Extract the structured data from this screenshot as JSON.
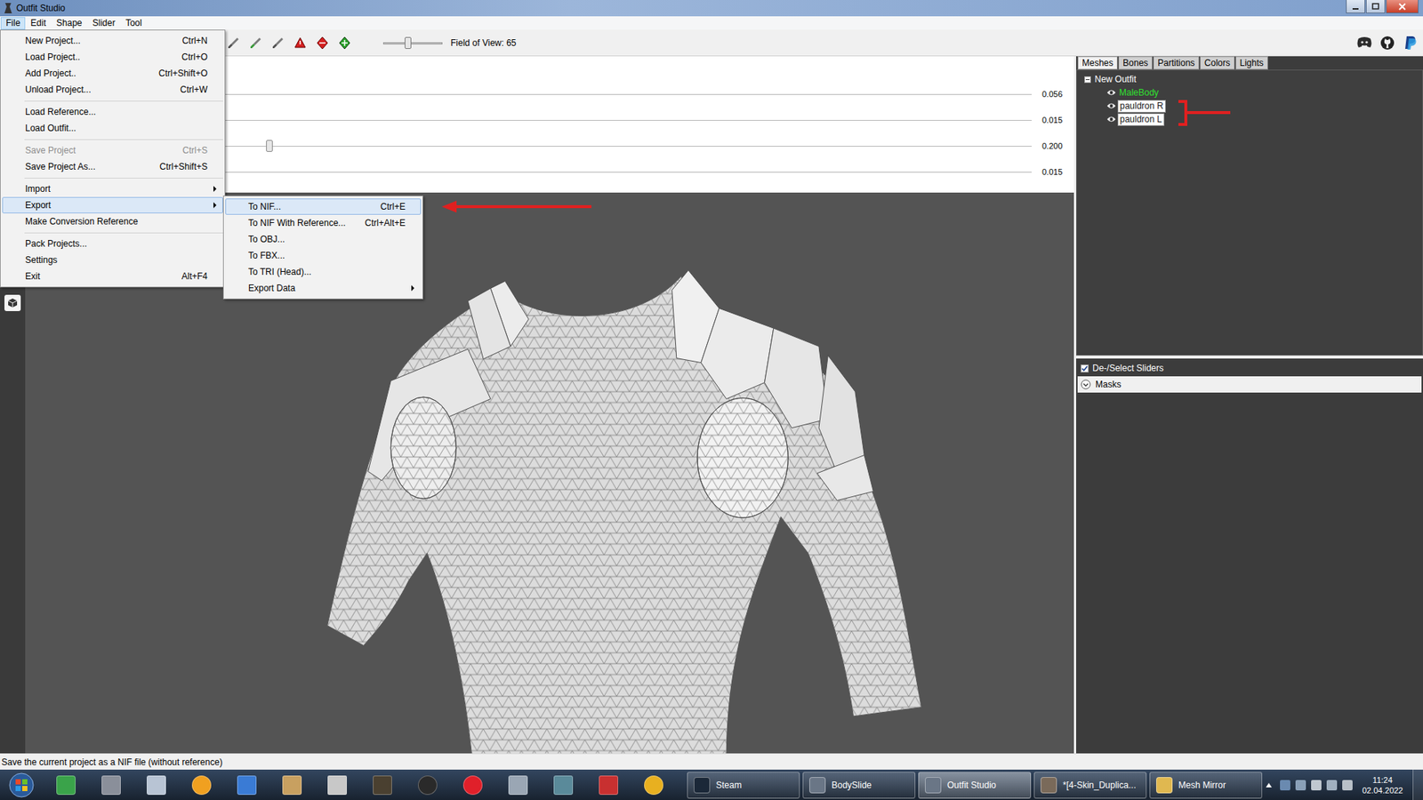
{
  "window": {
    "title": "Outfit Studio"
  },
  "menubar": [
    {
      "label": "File",
      "selected": true
    },
    {
      "label": "Edit",
      "selected": false
    },
    {
      "label": "Shape",
      "selected": false
    },
    {
      "label": "Slider",
      "selected": false
    },
    {
      "label": "Tool",
      "selected": false
    }
  ],
  "toolbar": {
    "fov_label": "Field of View: 65",
    "fov_level": 0.41
  },
  "sliders": [
    {
      "value": "0.056",
      "level": 0.05
    },
    {
      "value": "0.015",
      "level": 0.01
    },
    {
      "value": "0.200",
      "level": 0.25
    },
    {
      "value": "0.015",
      "level": 0.01
    }
  ],
  "panel_tabs": [
    {
      "label": "Meshes",
      "selected": true
    },
    {
      "label": "Bones",
      "selected": false
    },
    {
      "label": "Partitions",
      "selected": false
    },
    {
      "label": "Colors",
      "selected": false
    },
    {
      "label": "Lights",
      "selected": false
    }
  ],
  "tree": {
    "root": "New Outfit",
    "expanded": true,
    "items": [
      {
        "name": "MaleBody",
        "visible": true,
        "selected": false,
        "color": "#2fe02f"
      },
      {
        "name": "pauldron R",
        "visible": true,
        "selected": true,
        "color": "#1a1a1a"
      },
      {
        "name": "pauldron L",
        "visible": true,
        "selected": true,
        "color": "#1a1a1a"
      }
    ]
  },
  "sliders_toggle": {
    "label": "De-/Select Sliders",
    "checked": true
  },
  "masks": {
    "label": "Masks",
    "expanded": false
  },
  "status_bar": "Save the current project as a NIF file (without reference)",
  "file_menu": {
    "groups": [
      [
        {
          "label": "New Project...",
          "shortcut": "Ctrl+N",
          "disabled": false,
          "submenu": false,
          "selected": false
        },
        {
          "label": "Load Project..",
          "shortcut": "Ctrl+O",
          "disabled": false,
          "submenu": false,
          "selected": false
        },
        {
          "label": "Add Project..",
          "shortcut": "Ctrl+Shift+O",
          "disabled": false,
          "submenu": false,
          "selected": false
        },
        {
          "label": "Unload Project...",
          "shortcut": "Ctrl+W",
          "disabled": false,
          "submenu": false,
          "selected": false
        }
      ],
      [
        {
          "label": "Load Reference...",
          "shortcut": "",
          "disabled": false,
          "submenu": false,
          "selected": false
        },
        {
          "label": "Load Outfit...",
          "shortcut": "",
          "disabled": false,
          "submenu": false,
          "selected": false
        }
      ],
      [
        {
          "label": "Save Project",
          "shortcut": "Ctrl+S",
          "disabled": true,
          "submenu": false,
          "selected": false
        },
        {
          "label": "Save Project As...",
          "shortcut": "Ctrl+Shift+S",
          "disabled": false,
          "submenu": false,
          "selected": false
        }
      ],
      [
        {
          "label": "Import",
          "shortcut": "",
          "disabled": false,
          "submenu": true,
          "selected": false
        },
        {
          "label": "Export",
          "shortcut": "",
          "disabled": false,
          "submenu": true,
          "selected": true
        },
        {
          "label": "Make Conversion Reference",
          "shortcut": "",
          "disabled": false,
          "submenu": false,
          "selected": false
        }
      ],
      [
        {
          "label": "Pack Projects...",
          "shortcut": "",
          "disabled": false,
          "submenu": false,
          "selected": false
        },
        {
          "label": "Settings",
          "shortcut": "",
          "disabled": false,
          "submenu": false,
          "selected": false
        },
        {
          "label": "Exit",
          "shortcut": "Alt+F4",
          "disabled": false,
          "submenu": false,
          "selected": false
        }
      ]
    ]
  },
  "export_menu": {
    "items": [
      {
        "label": "To NIF...",
        "shortcut": "Ctrl+E",
        "submenu": false,
        "selected": true
      },
      {
        "label": "To NIF With Reference...",
        "shortcut": "Ctrl+Alt+E",
        "submenu": false,
        "selected": false
      },
      {
        "label": "To OBJ...",
        "shortcut": "",
        "submenu": false,
        "selected": false
      },
      {
        "label": "To FBX...",
        "shortcut": "",
        "submenu": false,
        "selected": false
      },
      {
        "label": "To TRI (Head)...",
        "shortcut": "",
        "submenu": false,
        "selected": false
      },
      {
        "label": "Export Data",
        "shortcut": "",
        "submenu": true,
        "selected": false
      }
    ]
  },
  "taskbar": {
    "tasks": [
      {
        "label": "Steam",
        "selected": false
      },
      {
        "label": "BodySlide",
        "selected": false
      },
      {
        "label": "Outfit Studio",
        "selected": true
      },
      {
        "label": "*[4-Skin_Duplica...",
        "selected": false
      },
      {
        "label": "Mesh Mirror",
        "selected": false
      }
    ],
    "clock": {
      "time": "11:24",
      "date": "02.04.2022"
    }
  }
}
